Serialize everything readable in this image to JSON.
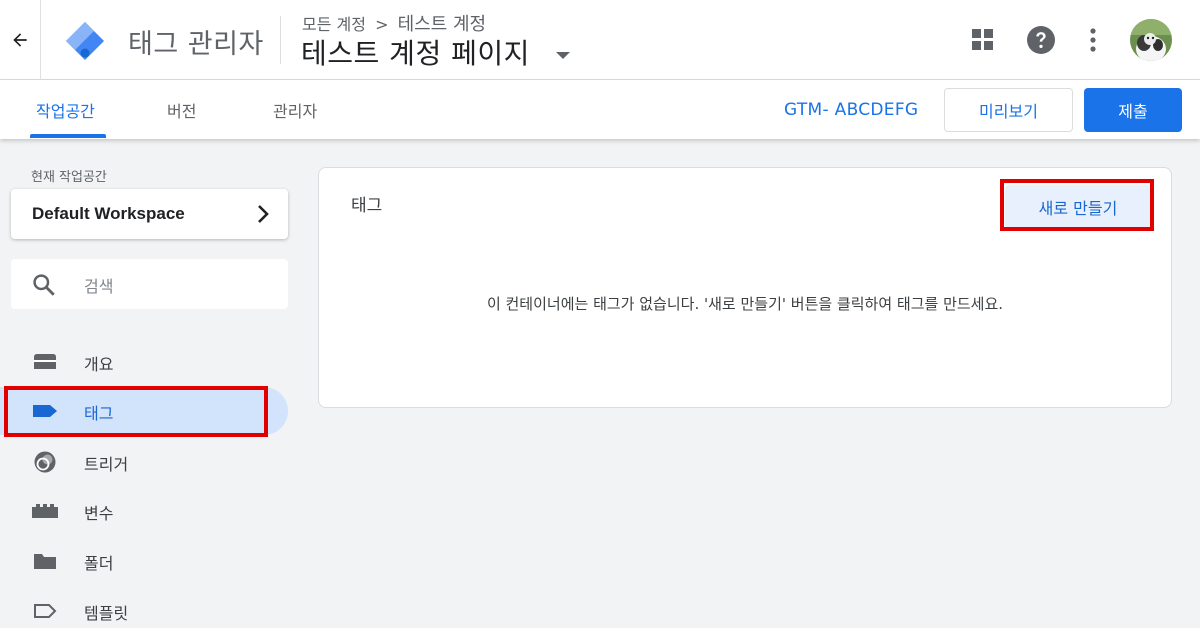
{
  "header": {
    "app_title": "태그 관리자",
    "breadcrumb": {
      "root": "모든 계정",
      "separator": ">",
      "current": "테스트 계정"
    },
    "account_name": "테스트 계정 페이지"
  },
  "icons": {
    "back": "arrow-left-icon",
    "logo": "tag-manager-logo",
    "apps": "apps-grid-icon",
    "help": "help-circle-icon",
    "more": "more-vert-icon",
    "dropdown": "caret-down-icon",
    "chevron": "chevron-right-icon",
    "search": "search-icon"
  },
  "tabs": [
    {
      "label": "작업공간",
      "active": true
    },
    {
      "label": "버전",
      "active": false
    },
    {
      "label": "관리자",
      "active": false
    }
  ],
  "container_id": "GTM- ABCDEFG",
  "actions": {
    "preview_label": "미리보기",
    "submit_label": "제출"
  },
  "sidebar": {
    "current_workspace_label": "현재 작업공간",
    "workspace_name": "Default Workspace",
    "search_placeholder": "검색",
    "items": [
      {
        "label": "개요",
        "icon": "overview-icon",
        "active": false
      },
      {
        "label": "태그",
        "icon": "tag-icon",
        "active": true
      },
      {
        "label": "트리거",
        "icon": "trigger-icon",
        "active": false
      },
      {
        "label": "변수",
        "icon": "variables-icon",
        "active": false
      },
      {
        "label": "폴더",
        "icon": "folder-icon",
        "active": false
      },
      {
        "label": "템플릿",
        "icon": "template-icon",
        "active": false
      }
    ]
  },
  "main": {
    "title": "태그",
    "new_button_label": "새로 만들기",
    "empty_message": "이 컨테이너에는 태그가 없습니다. '새로 만들기' 버튼을 클릭하여 태그를 만드세요."
  },
  "colors": {
    "accent": "#1a73e8",
    "active_nav_bg": "#d2e3fc",
    "highlight_box": "#e00000",
    "page_bg": "#f1f3f4"
  }
}
